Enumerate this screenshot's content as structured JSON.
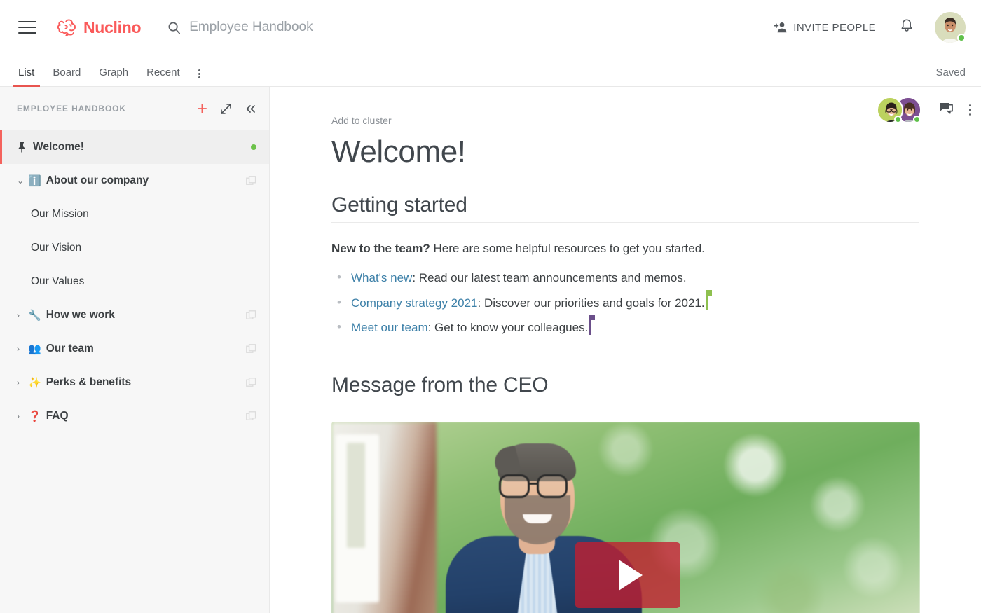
{
  "topbar": {
    "menu_icon": "hamburger-icon",
    "brand": "Nuclino",
    "brand_color": "#fa5a5a",
    "search": {
      "icon": "search-icon",
      "value": "Employee Handbook"
    },
    "invite_label": "INVITE PEOPLE",
    "invite_icon": "person-add-icon",
    "notifications_icon": "bell-icon",
    "avatar": {
      "name": "user-avatar",
      "status": "online",
      "status_color": "#5fc04a"
    }
  },
  "tabs": {
    "items": [
      {
        "label": "List",
        "active": true
      },
      {
        "label": "Board",
        "active": false
      },
      {
        "label": "Graph",
        "active": false
      },
      {
        "label": "Recent",
        "active": false
      }
    ],
    "overflow_icon": "more-vertical-icon",
    "status": "Saved",
    "active_underline_color": "#e8544f"
  },
  "sidebar": {
    "title": "EMPLOYEE HANDBOOK",
    "actions": {
      "add": "+",
      "expand_icon": "expand-icon",
      "collapse_icon": "collapse-left-icon"
    },
    "items": [
      {
        "label": "Welcome!",
        "emoji": "",
        "pin": true,
        "active": true,
        "bold": true,
        "chevron": "",
        "child": false,
        "dot": true,
        "cluster": false
      },
      {
        "label": "About our company",
        "emoji": "ℹ️",
        "pin": false,
        "active": false,
        "bold": true,
        "chevron": "⌄",
        "child": false,
        "dot": false,
        "cluster": true
      },
      {
        "label": "Our Mission",
        "emoji": "",
        "pin": false,
        "active": false,
        "bold": false,
        "chevron": "",
        "child": true,
        "dot": false,
        "cluster": false
      },
      {
        "label": "Our Vision",
        "emoji": "",
        "pin": false,
        "active": false,
        "bold": false,
        "chevron": "",
        "child": true,
        "dot": false,
        "cluster": false
      },
      {
        "label": "Our Values",
        "emoji": "",
        "pin": false,
        "active": false,
        "bold": false,
        "chevron": "",
        "child": true,
        "dot": false,
        "cluster": false
      },
      {
        "label": "How we work",
        "emoji": "🔧",
        "pin": false,
        "active": false,
        "bold": true,
        "chevron": "›",
        "child": false,
        "dot": false,
        "cluster": true
      },
      {
        "label": "Our team",
        "emoji": "👥",
        "pin": false,
        "active": false,
        "bold": true,
        "chevron": "›",
        "child": false,
        "dot": false,
        "cluster": true
      },
      {
        "label": "Perks & benefits",
        "emoji": "✨",
        "pin": false,
        "active": false,
        "bold": true,
        "chevron": "›",
        "child": false,
        "dot": false,
        "cluster": true
      },
      {
        "label": "FAQ",
        "emoji": "❓",
        "pin": false,
        "active": false,
        "bold": true,
        "chevron": "›",
        "child": false,
        "dot": false,
        "cluster": true
      }
    ]
  },
  "content": {
    "actions": {
      "collaborators": [
        {
          "name": "collaborator-avatar-1",
          "bg": "#bcd25f",
          "status": "online"
        },
        {
          "name": "collaborator-avatar-2",
          "bg": "#7d4f92",
          "status": "online"
        }
      ],
      "comment_icon": "comment-icon",
      "more_icon": "more-vertical-icon"
    },
    "breadcrumb": "Add to cluster",
    "title": "Welcome!",
    "sections": [
      {
        "heading": "Getting started",
        "ruled": true,
        "intro_bold": "New to the team?",
        "intro_rest": " Here are some helpful resources to get you started.",
        "bullets": [
          {
            "link": "What's new",
            "rest": ": Read our latest team announcements and memos.",
            "caret": ""
          },
          {
            "link": "Company strategy 2021",
            "rest": ": Discover our priorities and goals for 2021.",
            "caret": "green"
          },
          {
            "link": "Meet our team",
            "rest": ": Get to know your colleagues.",
            "caret": "purple"
          }
        ]
      },
      {
        "heading": "Message from the CEO",
        "ruled": false
      }
    ],
    "video": {
      "name": "ceo-video-embed",
      "play_button": "play-button",
      "play_color": "#c41e30",
      "description": "Smiling bearded man with glasses in a navy blazer outdoors with blurred green foliage"
    },
    "link_color": "#3d80a8",
    "caret_colors": {
      "green": "#8ec04f",
      "purple": "#6b4f8a"
    }
  }
}
